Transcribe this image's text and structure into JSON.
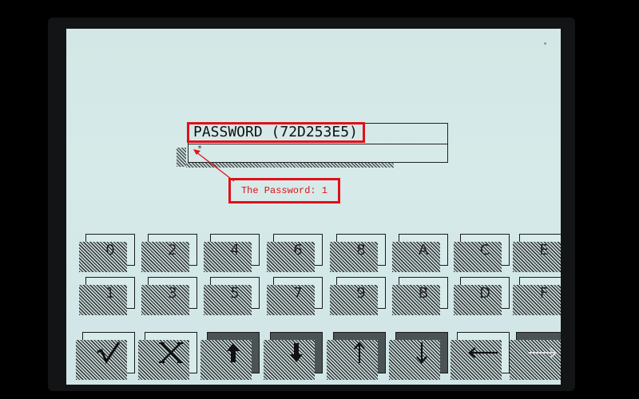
{
  "password_prompt": {
    "label": "PASSWORD (72D253E5)",
    "entered_value": "*"
  },
  "annotation": {
    "text": "The Password: 1",
    "color": "#e0101a"
  },
  "keypad": {
    "row1": [
      "0",
      "2",
      "4",
      "6",
      "8",
      "A",
      "C",
      "E"
    ],
    "row2": [
      "1",
      "3",
      "5",
      "7",
      "9",
      "B",
      "D",
      "F"
    ],
    "actions": [
      {
        "name": "confirm-button",
        "icon": "checkmark-icon",
        "glyph": "√"
      },
      {
        "name": "cancel-button",
        "icon": "x-icon",
        "glyph": "X"
      },
      {
        "name": "page-up-button",
        "icon": "bold-up-arrow-icon"
      },
      {
        "name": "page-down-button",
        "icon": "bold-down-arrow-icon"
      },
      {
        "name": "up-button",
        "icon": "up-arrow-icon"
      },
      {
        "name": "down-button",
        "icon": "down-arrow-icon"
      },
      {
        "name": "backspace-button",
        "icon": "left-arrow-icon"
      },
      {
        "name": "next-button",
        "icon": "right-arrow-icon"
      }
    ]
  }
}
